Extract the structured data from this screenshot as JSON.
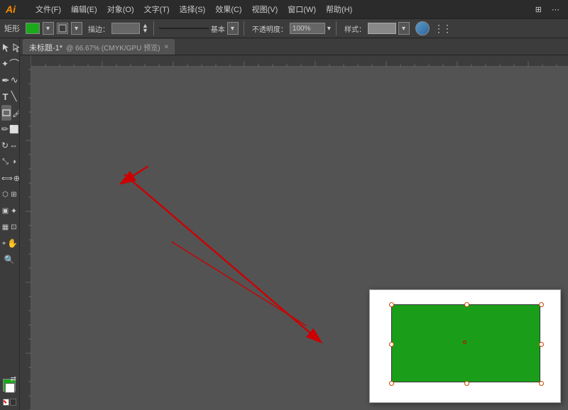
{
  "titlebar": {
    "logo": "Ai",
    "menus": [
      "文件(F)",
      "编辑(E)",
      "对象(O)",
      "文字(T)",
      "选择(S)",
      "效果(C)",
      "视图(V)",
      "窗口(W)",
      "帮助(H)"
    ]
  },
  "toolbar": {
    "tool_label": "矩形",
    "fill_color": "#1aaa1a",
    "stroke_label": "描边：",
    "stroke_value": "",
    "line_style": "基本",
    "opacity_label": "不透明度：",
    "opacity_value": "100%",
    "style_label": "样式：",
    "arrow_label": "▲▼"
  },
  "tab": {
    "title": "未标题-1*",
    "subtitle": "@ 66.67% (CMYK/GPU 预览)",
    "close": "×"
  },
  "tools": [
    {
      "name": "select-tool",
      "icon": "▸",
      "active": false
    },
    {
      "name": "direct-select-tool",
      "icon": "↖",
      "active": false
    },
    {
      "name": "magic-wand-tool",
      "icon": "✦",
      "active": false
    },
    {
      "name": "lasso-tool",
      "icon": "⌒",
      "active": false
    },
    {
      "name": "pen-tool",
      "icon": "✒",
      "active": false
    },
    {
      "name": "curvature-tool",
      "icon": "ꕔ",
      "active": false
    },
    {
      "name": "type-tool",
      "icon": "T",
      "active": false
    },
    {
      "name": "line-tool",
      "icon": "╲",
      "active": false
    },
    {
      "name": "rect-tool",
      "icon": "□",
      "active": true
    },
    {
      "name": "brush-tool",
      "icon": "∫",
      "active": false
    },
    {
      "name": "pencil-tool",
      "icon": "✏",
      "active": false
    },
    {
      "name": "rotate-tool",
      "icon": "↻",
      "active": false
    },
    {
      "name": "reflect-tool",
      "icon": "⇔",
      "active": false
    },
    {
      "name": "scale-tool",
      "icon": "⤡",
      "active": false
    },
    {
      "name": "warp-tool",
      "icon": "⌀",
      "active": false
    },
    {
      "name": "width-tool",
      "icon": "⟺",
      "active": false
    },
    {
      "name": "shape-builder-tool",
      "icon": "⊕",
      "active": false
    },
    {
      "name": "perspective-tool",
      "icon": "⬡",
      "active": false
    },
    {
      "name": "symbol-sprayer-tool",
      "icon": "✼",
      "active": false
    },
    {
      "name": "bar-graph-tool",
      "icon": "▦",
      "active": false
    },
    {
      "name": "artboard-tool",
      "icon": "⊡",
      "active": false
    },
    {
      "name": "slice-tool",
      "icon": "⌖",
      "active": false
    },
    {
      "name": "eraser-tool",
      "icon": "◪",
      "active": false
    },
    {
      "name": "scissors-tool",
      "icon": "✂",
      "active": false
    },
    {
      "name": "hand-tool",
      "icon": "✋",
      "active": false
    },
    {
      "name": "zoom-tool",
      "icon": "⊕",
      "active": false
    }
  ],
  "colors": {
    "foreground": "#1aaa1a",
    "background": "#ffffff"
  },
  "canvas": {
    "zoom": "66.67%",
    "color_mode": "CMYK/GPU 预览"
  }
}
